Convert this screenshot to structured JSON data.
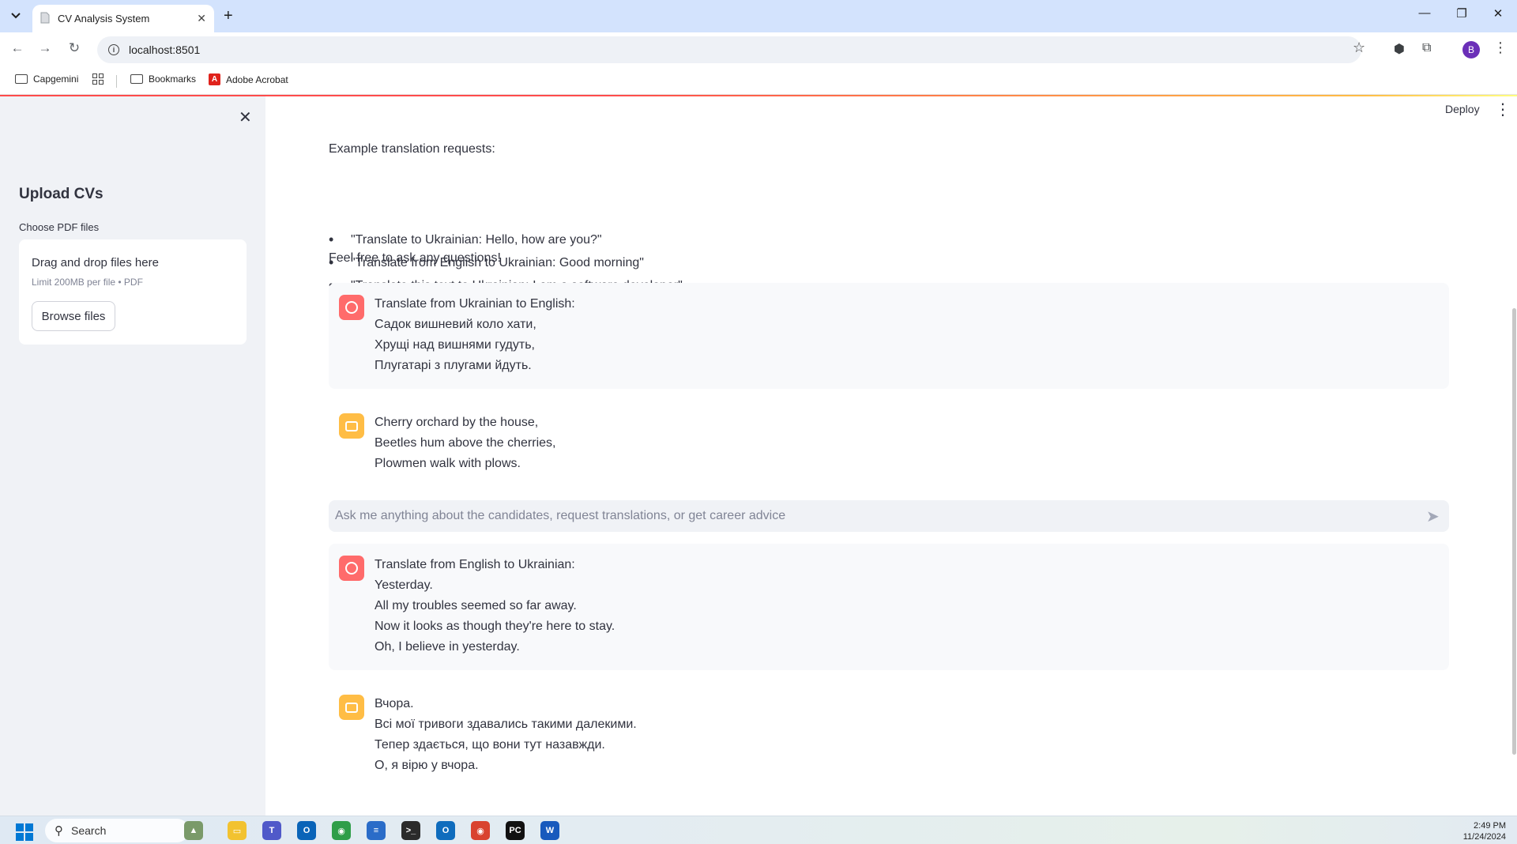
{
  "browser": {
    "tab_title": "CV Analysis System",
    "tab_close": "✕",
    "new_tab": "+",
    "url": "localhost:8501",
    "profile_initial": "B",
    "window_controls": {
      "minimize": "—",
      "restore": "❐",
      "close": "✕"
    },
    "bookmarks": [
      {
        "label": "Capgemini",
        "icon": "folder-shared-icon"
      },
      {
        "label": "Bookmarks",
        "icon": "folder-icon"
      },
      {
        "label": "Adobe Acrobat",
        "icon": "acrobat-icon"
      }
    ]
  },
  "sidebar": {
    "title": "Upload CVs",
    "uploader_label": "Choose PDF files",
    "dropzone_title": "Drag and drop files here",
    "dropzone_limit": "Limit 200MB per file • PDF",
    "browse_button": "Browse files"
  },
  "header": {
    "deploy_label": "Deploy"
  },
  "main": {
    "intro_heading": "Example translation requests:",
    "examples": [
      "\"Translate to Ukrainian: Hello, how are you?\"",
      "\"Translate from English to Ukrainian: Good morning\"",
      "\"Translate this text to Ukrainian: I am a software developer\""
    ],
    "outro": "Feel free to ask any questions!",
    "messages": [
      {
        "role": "user",
        "lines": [
          "Translate from Ukrainian to English:",
          "Садок вишневий коло хати,",
          "Хрущі над вишнями гудуть,",
          "Плугатарі з плугами йдуть."
        ]
      },
      {
        "role": "assistant",
        "lines": [
          "Cherry orchard by the house,",
          "Beetles hum above the cherries,",
          "Plowmen walk with plows."
        ]
      },
      {
        "role": "user",
        "lines": [
          "Translate from English to Ukrainian:",
          "Yesterday.",
          "All my troubles seemed so far away.",
          "Now it looks as though they're here to stay.",
          "Oh, I believe in yesterday."
        ]
      },
      {
        "role": "assistant",
        "lines": [
          "Вчора.",
          "Всі мої тривоги здавались такими далекими.",
          "Тепер здається, що вони тут назавжди.",
          "О, я вірю у вчора."
        ]
      }
    ],
    "chat_input_placeholder": "Ask me anything about the candidates, request translations, or get career advice"
  },
  "taskbar": {
    "search_label": "Search",
    "time": "2:49 PM",
    "date": "11/24/2024"
  },
  "colors": {
    "user_avatar": "#ff6b6b",
    "assistant_avatar": "#ffbd45",
    "sidebar_bg": "#f0f2f6",
    "accent_red": "#ff4b4b"
  }
}
